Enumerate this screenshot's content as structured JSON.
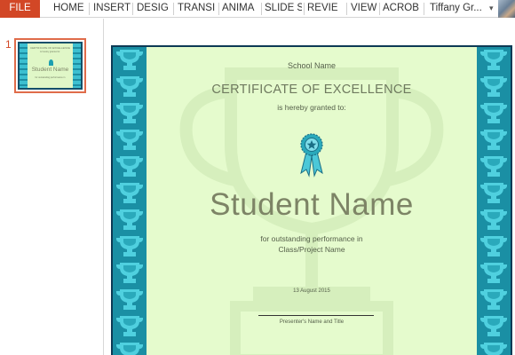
{
  "ribbon": {
    "tabs": [
      "FILE",
      "HOME",
      "INSERT",
      "DESIG",
      "TRANSI",
      "ANIMA",
      "SLIDE S",
      "REVIE",
      "VIEW",
      "ACROB"
    ],
    "user_name": "Tiffany Gr...",
    "user_caret": "▾",
    "file_color": "#d24726"
  },
  "thumbnails": {
    "slide_number": "1"
  },
  "certificate": {
    "school_name": "School Name",
    "title": "CERTIFICATE OF EXCELLENCE",
    "granted": "is hereby granted to:",
    "student_name": "Student Name",
    "performance_line1": "for outstanding performance in",
    "performance_line2": "Class/Project Name",
    "date": "13 August 2015",
    "presenter": "Presenter's Name and Title",
    "award_icon": "ribbon-award-icon",
    "border_color": "#1a8fa4",
    "background_color": "#e5fbcd"
  }
}
